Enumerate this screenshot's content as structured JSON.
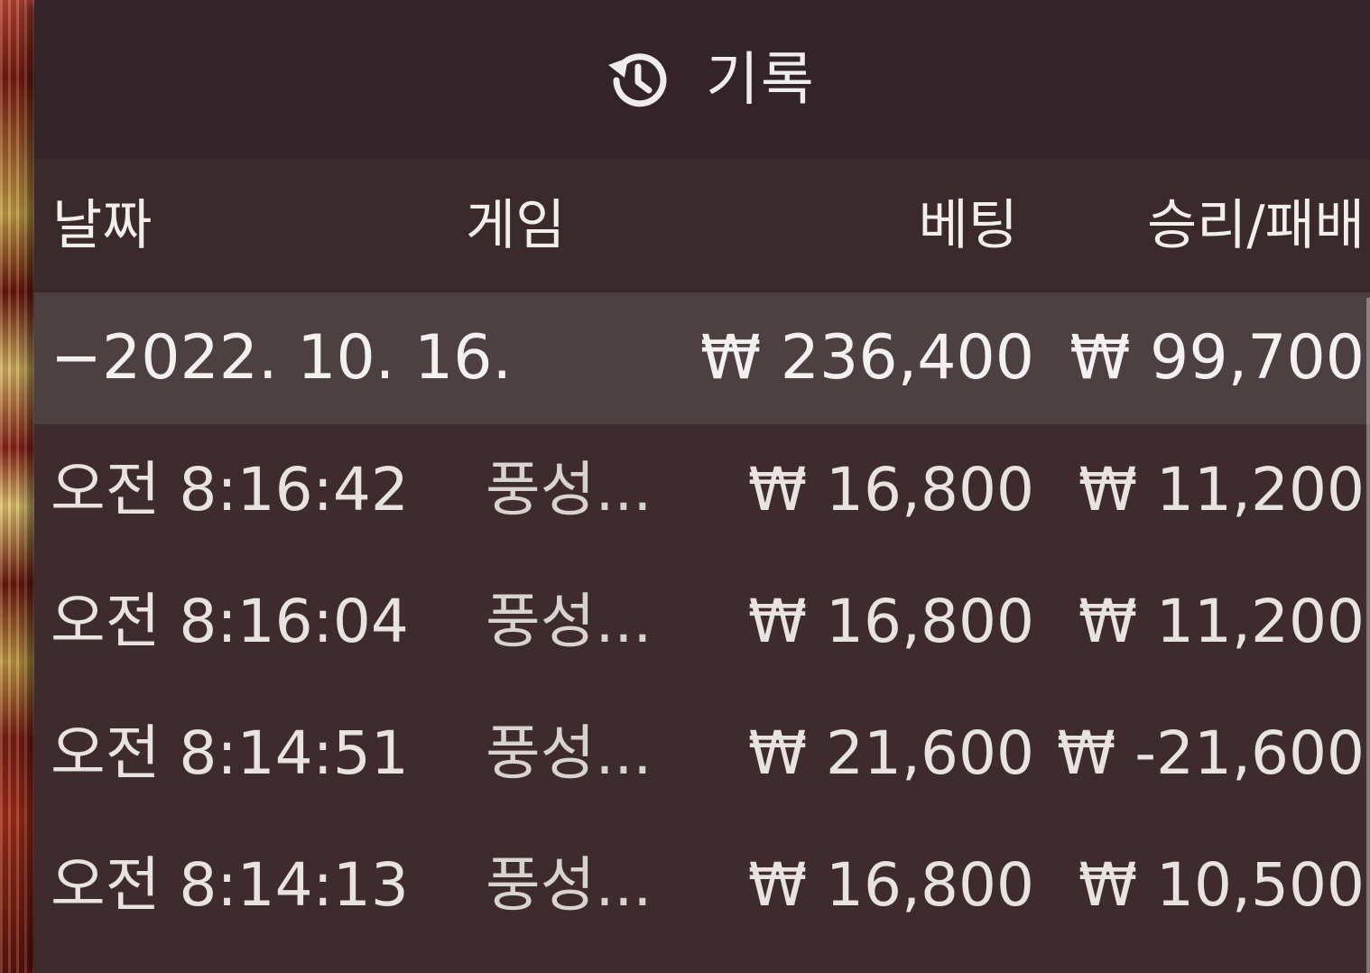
{
  "panel": {
    "title": "기록",
    "icon": "history-icon"
  },
  "columns": {
    "date": "날짜",
    "game": "게임",
    "bet": "베팅",
    "win_loss": "승리/패배"
  },
  "summary": {
    "date": "−2022. 10. 16.",
    "bet": "₩ 236,400",
    "win_loss": "₩ 99,700"
  },
  "rows": [
    {
      "time": "오전 8:16:42",
      "game": "풍성...",
      "bet": "₩ 16,800",
      "win_loss": "₩ 11,200"
    },
    {
      "time": "오전 8:16:04",
      "game": "풍성...",
      "bet": "₩ 16,800",
      "win_loss": "₩ 11,200"
    },
    {
      "time": "오전 8:14:51",
      "game": "풍성...",
      "bet": "₩ 21,600",
      "win_loss": "₩ -21,600"
    },
    {
      "time": "오전 8:14:13",
      "game": "풍성...",
      "bet": "₩ 16,800",
      "win_loss": "₩ 10,500"
    }
  ],
  "colors": {
    "panel_bg": "#3d2b2e",
    "header_bg": "#33242a",
    "summary_bg": "#4c4043",
    "text": "#e8e2e3"
  }
}
